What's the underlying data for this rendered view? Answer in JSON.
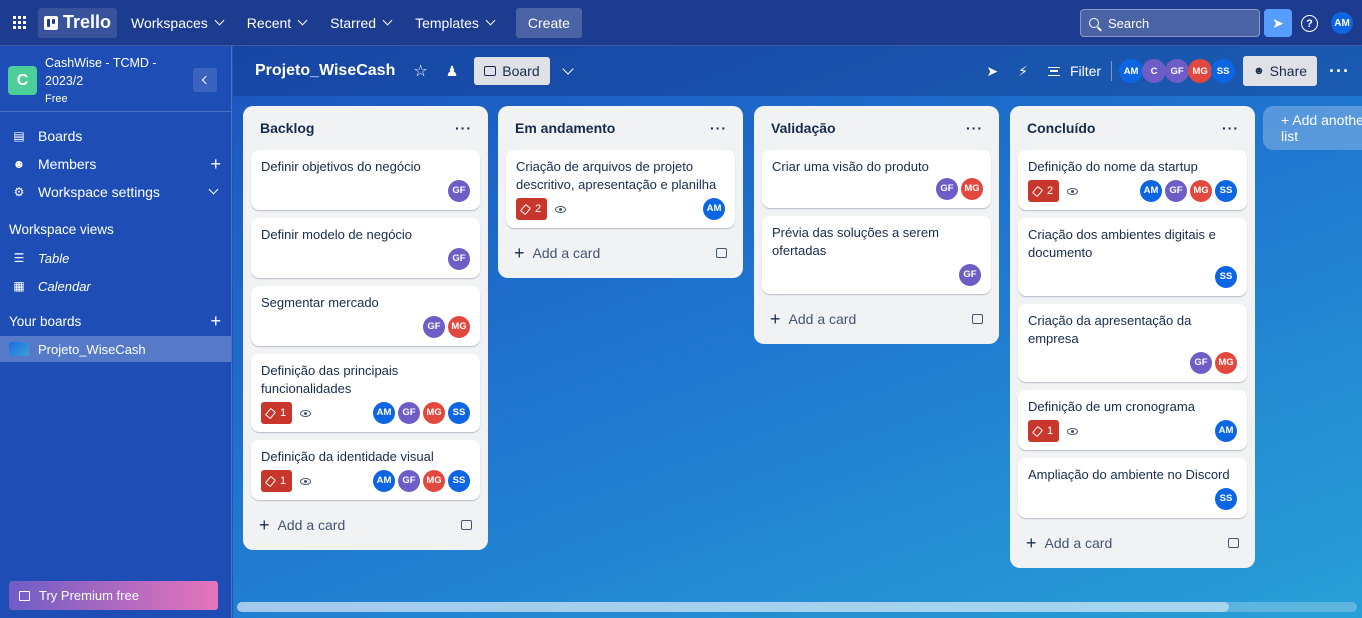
{
  "topbar": {
    "logo": "Trello",
    "nav": [
      "Workspaces",
      "Recent",
      "Starred",
      "Templates"
    ],
    "create": "Create",
    "search_placeholder": "Search",
    "help": "?",
    "user": "AM"
  },
  "sidebar": {
    "workspace_initial": "C",
    "workspace_name": "CashWise - TCMD - 2023/2",
    "workspace_plan": "Free",
    "items": [
      {
        "label": "Boards"
      },
      {
        "label": "Members"
      },
      {
        "label": "Workspace settings"
      }
    ],
    "views_title": "Workspace views",
    "views": [
      "Table",
      "Calendar"
    ],
    "your_boards_title": "Your boards",
    "boards": [
      "Projeto_WiseCash"
    ],
    "premium": "Try Premium free"
  },
  "board_header": {
    "title": "Projeto_WiseCash",
    "view": "Board",
    "filter": "Filter",
    "share": "Share",
    "members": [
      {
        "initials": "AM",
        "color": "#0c66e4"
      },
      {
        "initials": "C",
        "color": "#6e5dc6"
      },
      {
        "initials": "GF",
        "color": "#6e5dc6"
      },
      {
        "initials": "MG",
        "color": "#e2483d"
      },
      {
        "initials": "SS",
        "color": "#0c66e4"
      }
    ]
  },
  "colors": {
    "AM": "#0c66e4",
    "GF": "#6e5dc6",
    "MG": "#e2483d",
    "SS": "#0c66e4"
  },
  "lists": [
    {
      "title": "Backlog",
      "cards": [
        {
          "title": "Definir objetivos do negócio",
          "badge": null,
          "members": [
            "GF"
          ]
        },
        {
          "title": "Definir modelo de negócio",
          "badge": null,
          "members": [
            "GF"
          ]
        },
        {
          "title": "Segmentar mercado",
          "badge": null,
          "members": [
            "GF",
            "MG"
          ]
        },
        {
          "title": "Definição das principais funcionalidades",
          "badge": "1",
          "members": [
            "AM",
            "GF",
            "MG",
            "SS"
          ]
        },
        {
          "title": "Definição da identidade visual",
          "badge": "1",
          "members": [
            "AM",
            "GF",
            "MG",
            "SS"
          ]
        }
      ],
      "add_card": "Add a card"
    },
    {
      "title": "Em andamento",
      "cards": [
        {
          "title": "Criação de arquivos de projeto descritivo, apresentação e planilha",
          "badge": "2",
          "members": [
            "AM"
          ]
        }
      ],
      "add_card": "Add a card"
    },
    {
      "title": "Validação",
      "cards": [
        {
          "title": "Criar uma visão do produto",
          "badge": null,
          "members": [
            "GF",
            "MG"
          ],
          "inline": true
        },
        {
          "title": "Prévia das soluções a serem ofertadas",
          "badge": null,
          "members": [
            "GF"
          ]
        }
      ],
      "add_card": "Add a card"
    },
    {
      "title": "Concluído",
      "cards": [
        {
          "title": "Definição do nome da startup",
          "badge": "2",
          "members": [
            "AM",
            "GF",
            "MG",
            "SS"
          ]
        },
        {
          "title": "Criação dos ambientes digitais e documento",
          "badge": null,
          "members": [
            "SS"
          ]
        },
        {
          "title": "Criação da apresentação da empresa",
          "badge": null,
          "members": [
            "GF",
            "MG"
          ]
        },
        {
          "title": "Definição de um cronograma",
          "badge": "1",
          "members": [
            "AM"
          ]
        },
        {
          "title": "Ampliação do ambiente no Discord",
          "badge": null,
          "members": [
            "SS"
          ]
        }
      ],
      "add_card": "Add a card"
    }
  ],
  "add_list": "+ Add another list"
}
